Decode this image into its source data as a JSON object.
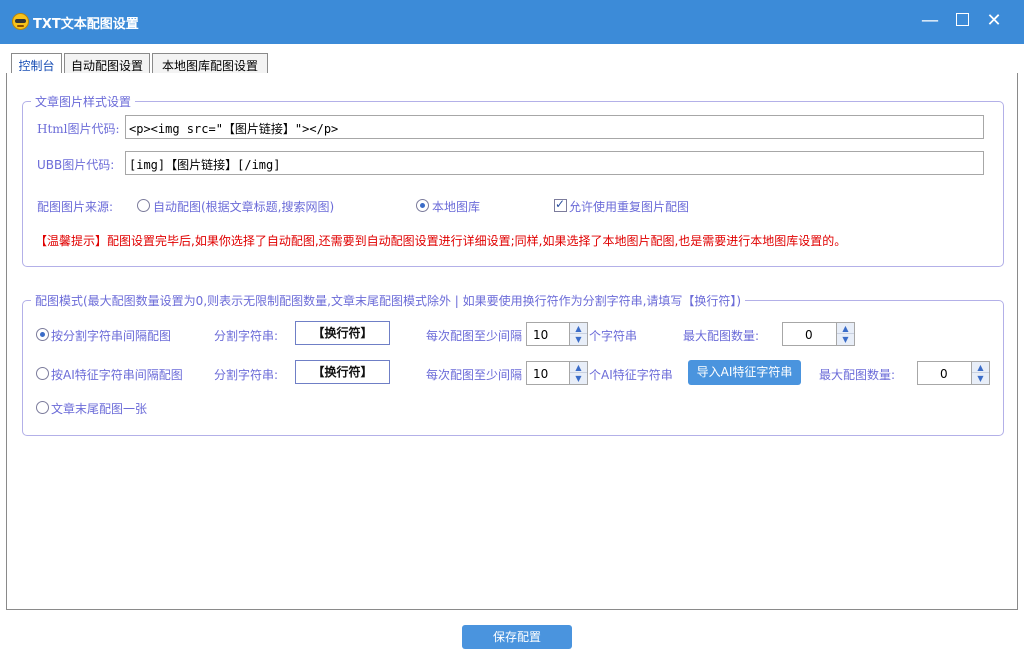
{
  "window": {
    "title": "TXT文本配图设置",
    "minimize_icon": "minimize-icon",
    "maximize_icon": "maximize-icon",
    "close_icon": "close-icon"
  },
  "tabs": [
    {
      "label": "控制台",
      "active": true
    },
    {
      "label": "自动配图设置",
      "active": false
    },
    {
      "label": "本地图库配图设置",
      "active": false
    }
  ],
  "style_group": {
    "title": "文章图片样式设置",
    "html_label": "Html图片代码:",
    "html_value": "<p><img src=\"【图片链接】\"></p>",
    "ubb_label": "UBB图片代码:",
    "ubb_value": "[img]【图片链接】[/img]",
    "source_label": "配图图片来源:",
    "source_options": [
      {
        "label": "自动配图(根据文章标题,搜索网图)",
        "selected": false
      },
      {
        "label": "本地图库",
        "selected": true
      }
    ],
    "allow_repeat_label": "允许使用重复图片配图",
    "allow_repeat_checked": true,
    "tip": "【温馨提示】配图设置完毕后,如果你选择了自动配图,还需要到自动配图设置进行详细设置;同样,如果选择了本地图片配图,也是需要进行本地图库设置的。"
  },
  "mode_group": {
    "title": "配图模式(最大配图数量设置为0,则表示无限制配图数量,文章末尾配图模式除外  |  如果要使用换行符作为分割字符串,请填写【换行符】)",
    "rows": [
      {
        "radio_label": "按分割字符串间隔配图",
        "selected": true,
        "sep_label": "分割字符串:",
        "sep_value": "【换行符】",
        "interval_label": "每次配图至少间隔",
        "interval_value": "10",
        "unit_label": "个字符串",
        "max_label": "最大配图数量:",
        "max_value": "0"
      },
      {
        "radio_label": "按AI特征字符串间隔配图",
        "selected": false,
        "sep_label": "分割字符串:",
        "sep_value": "【换行符】",
        "interval_label": "每次配图至少间隔",
        "interval_value": "10",
        "unit_label": "个AI特征字符串",
        "import_button": "导入AI特征字符串",
        "max_label": "最大配图数量:",
        "max_value": "0"
      }
    ],
    "end_option": {
      "radio_label": "文章末尾配图一张",
      "selected": false
    }
  },
  "footer": {
    "save_button": "保存配置"
  }
}
